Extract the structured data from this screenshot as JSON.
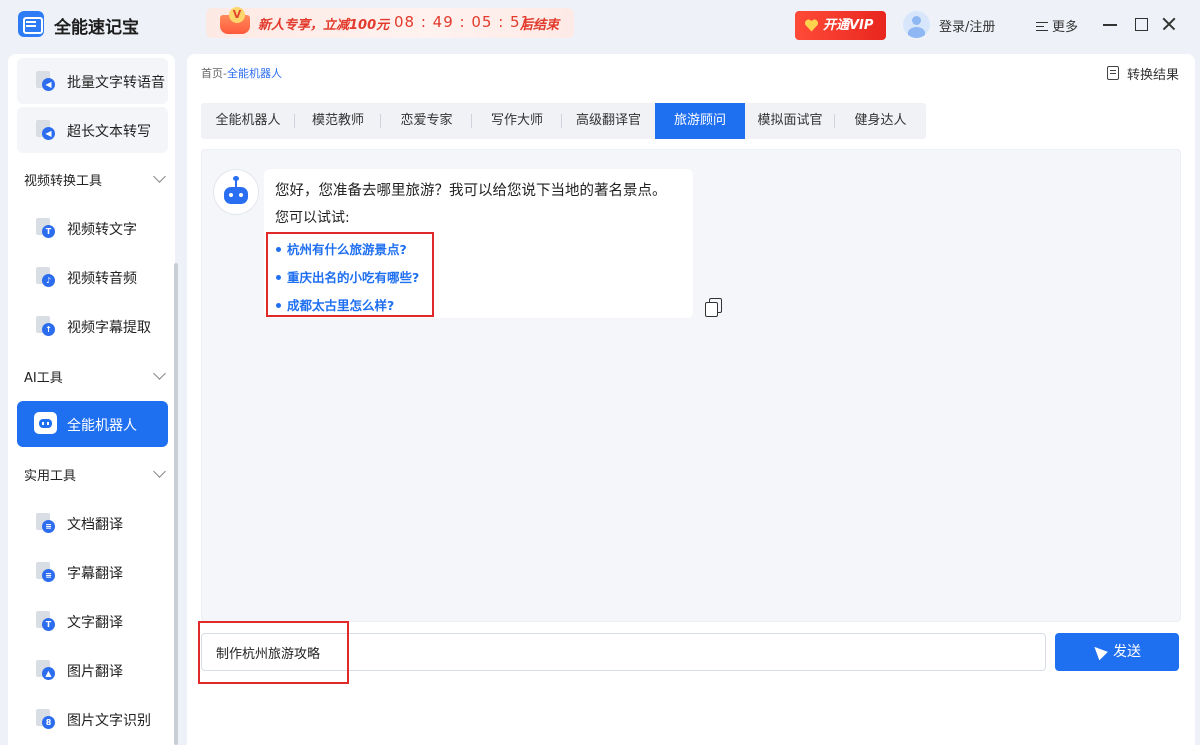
{
  "app": {
    "name": "全能速记宝",
    "promo": {
      "text": "新人专享，立减100元",
      "countdown": "08 : 49 : 05 : 51",
      "end": "后结束",
      "badge": "V"
    },
    "vip_label": "开通VIP",
    "login_label": "登录/注册",
    "more_label": "更多"
  },
  "sidebar": {
    "items_top": [
      {
        "label": "批量文字转语音"
      },
      {
        "label": "超长文本转写"
      }
    ],
    "groups": [
      {
        "title": "视频转换工具",
        "items": [
          {
            "label": "视频转文字",
            "badge": "T"
          },
          {
            "label": "视频转音频",
            "badge": "♪"
          },
          {
            "label": "视频字幕提取",
            "badge": "↑"
          }
        ]
      },
      {
        "title": "AI工具",
        "items": [
          {
            "label": "全能机器人"
          }
        ]
      },
      {
        "title": "实用工具",
        "items": [
          {
            "label": "文档翻译",
            "badge": "≡"
          },
          {
            "label": "字幕翻译",
            "badge": "≡"
          },
          {
            "label": "文字翻译",
            "badge": "T"
          },
          {
            "label": "图片翻译",
            "badge": "▲"
          },
          {
            "label": "图片文字识别",
            "badge": "8"
          }
        ]
      }
    ]
  },
  "main": {
    "breadcrumb": {
      "home": "首页",
      "sep": "-",
      "current": "全能机器人"
    },
    "convert_label": "转换结果",
    "tabs": [
      "全能机器人",
      "模范教师",
      "恋爱专家",
      "写作大师",
      "高级翻译官",
      "旅游顾问",
      "模拟面试官",
      "健身达人"
    ],
    "active_tab": "旅游顾问",
    "chat": {
      "greeting": "您好，您准备去哪里旅游？我可以给您说下当地的著名景点。",
      "try_label": "您可以试试:",
      "suggestions": [
        "杭州有什么旅游景点?",
        "重庆出名的小吃有哪些?",
        "成都太古里怎么样?"
      ]
    },
    "input_value": "制作杭州旅游攻略",
    "send_label": "发送"
  },
  "colors": {
    "accent": "#1f6ff1",
    "highlight_box": "#e02a2a",
    "promo_red": "#e23a2c"
  }
}
